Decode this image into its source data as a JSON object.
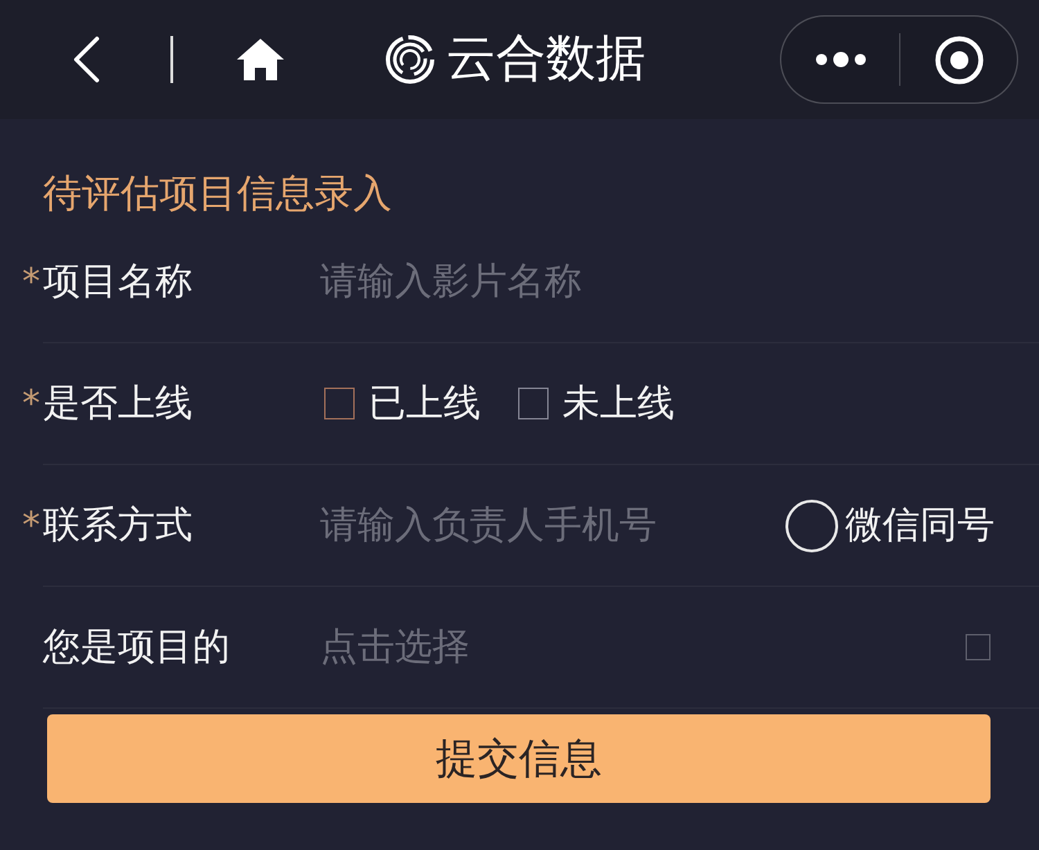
{
  "nav": {
    "title": "云合数据"
  },
  "form": {
    "title": "待评估项目信息录入",
    "rows": [
      {
        "kind": "text",
        "marker": "*",
        "label": "项目名称",
        "placeholder": "请输入影片名称"
      },
      {
        "kind": "choice",
        "marker": "*",
        "label": "是否上线",
        "options": [
          {
            "label": "已上线",
            "color": "#a3705a",
            "checked": false
          },
          {
            "label": "未上线",
            "color": "#858594",
            "checked": false
          }
        ]
      },
      {
        "kind": "phone",
        "marker": "*",
        "label": "联系方式",
        "placeholder": "请输入负责人手机号",
        "toggle": {
          "label": "微信同号",
          "checked": false
        }
      },
      {
        "kind": "picker",
        "label": "您是项目的",
        "placeholder": "点击选择",
        "checkbox": {
          "checked": false
        }
      }
    ]
  },
  "submit": {
    "label": "提交信息"
  }
}
